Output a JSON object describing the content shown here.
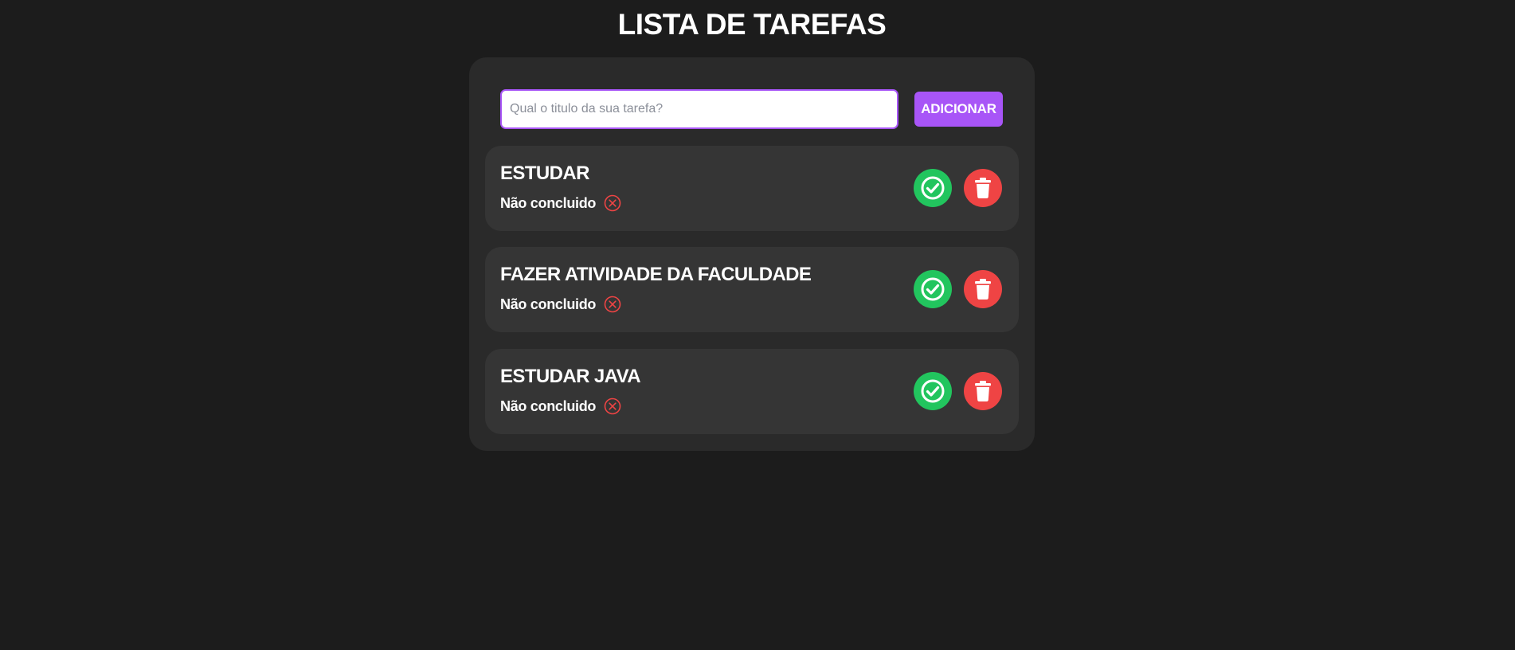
{
  "header": {
    "title": "LISTA DE TAREFAS"
  },
  "add_form": {
    "placeholder": "Qual o titulo da sua tarefa?",
    "value": "",
    "button_label": "ADICIONAR"
  },
  "tasks": [
    {
      "title": "ESTUDAR",
      "status": "Não concluido"
    },
    {
      "title": "FAZER ATIVIDADE DA FACULDADE",
      "status": "Não concluido"
    },
    {
      "title": "ESTUDAR JAVA",
      "status": "Não concluido"
    }
  ],
  "icons": {
    "status": "x-circle-icon",
    "complete": "check-circle-icon",
    "delete": "trash-icon"
  },
  "colors": {
    "background": "#1c1c1c",
    "card": "#2a2a2a",
    "task_card": "#353535",
    "accent": "#a855f7",
    "success": "#22c55e",
    "danger": "#ef4444"
  }
}
